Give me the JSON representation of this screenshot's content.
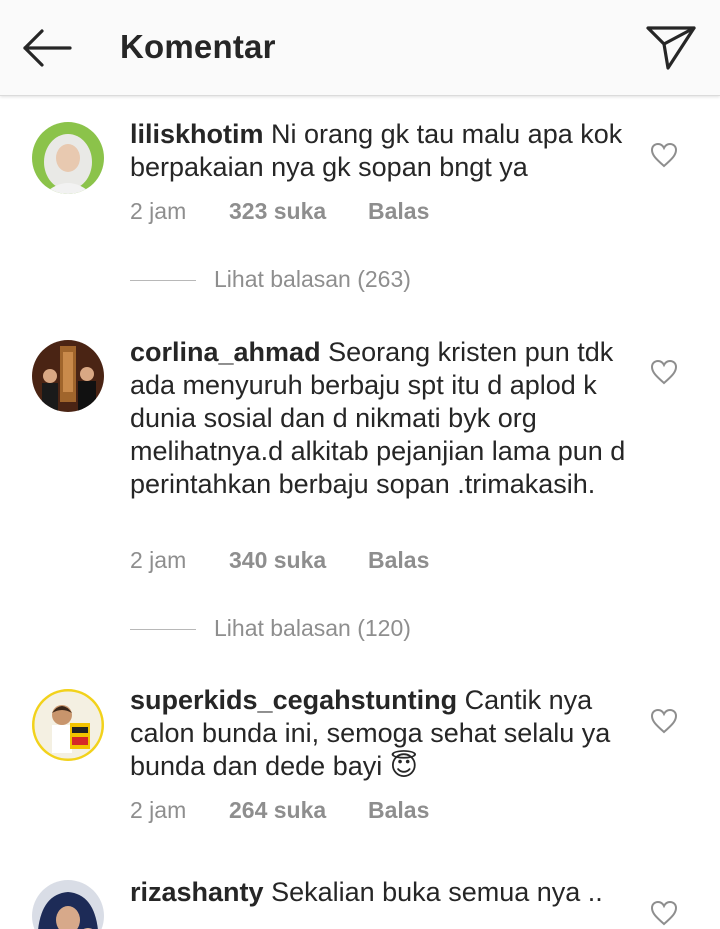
{
  "header": {
    "title": "Komentar",
    "back_icon": "arrow-left-icon",
    "send_icon": "paper-plane-icon"
  },
  "colors": {
    "text": "#262626",
    "muted": "#8e8e8e",
    "header_bg": "#fafafa"
  },
  "comments": [
    {
      "username": "liliskhotim",
      "text": "Ni orang gk tau malu apa kok berpakaian nya gk sopan bngt ya",
      "time": "2 jam",
      "likes": "323 suka",
      "reply": "Balas",
      "view_replies": "Lihat balasan (263)"
    },
    {
      "username": "corlina_ahmad",
      "text": "Seorang kristen pun tdk ada menyuruh berbaju spt itu d aplod k dunia sosial dan d nikmati byk org melihatnya.d alkitab pejanjian lama pun d perintahkan berbaju sopan .trimakasih.",
      "time": "2 jam",
      "likes": "340 suka",
      "reply": "Balas",
      "view_replies": "Lihat balasan (120)"
    },
    {
      "username": "superkids_cegahstunting",
      "text": "Cantik nya calon bunda ini, semoga sehat selalu ya bunda dan dede bayi 😇",
      "time": "2 jam",
      "likes": "264 suka",
      "reply": "Balas"
    },
    {
      "username": "rizashanty",
      "text": "Sekalian buka semua nya .."
    }
  ]
}
